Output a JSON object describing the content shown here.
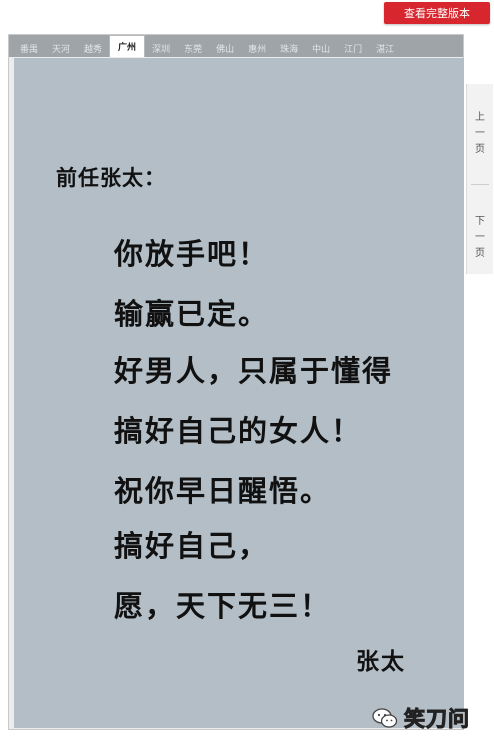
{
  "top_button": {
    "label": "查看完整版本"
  },
  "tabs": [
    {
      "label": "番禺"
    },
    {
      "label": "天河"
    },
    {
      "label": "越秀"
    },
    {
      "label": "广州"
    },
    {
      "label": "深圳"
    },
    {
      "label": "东莞"
    },
    {
      "label": "佛山"
    },
    {
      "label": "惠州"
    },
    {
      "label": "珠海"
    },
    {
      "label": "中山"
    },
    {
      "label": "江门"
    },
    {
      "label": "湛江"
    }
  ],
  "active_tab_index": 3,
  "letter": {
    "greeting": "前任张太：",
    "lines": [
      "你放手吧！",
      "输赢已定。",
      "好男人，只属于懂得",
      "搞好自己的女人！",
      "祝你早日醒悟。",
      "搞好自己，",
      "愿，天下无三！"
    ],
    "signature": "张太",
    "background_color": "#b3bec6"
  },
  "side_nav": {
    "prev_label": [
      "上",
      "一",
      "页"
    ],
    "next_label": [
      "下",
      "一",
      "页"
    ]
  },
  "watermark": {
    "label": "笑刀问",
    "icon": "wechat-icon"
  },
  "colors": {
    "accent": "#d8262e",
    "tab_bar": "#9ea4a8"
  }
}
